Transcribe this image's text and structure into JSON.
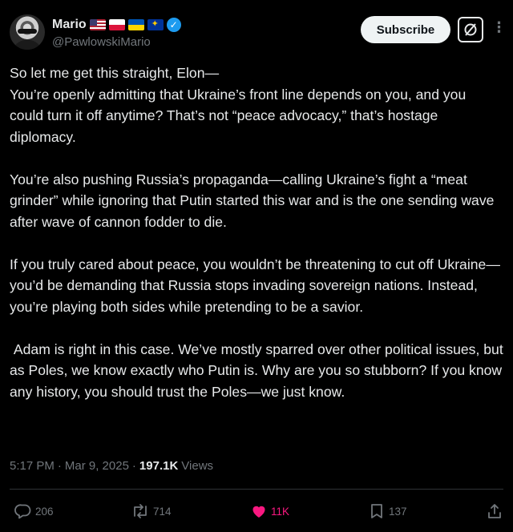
{
  "author": {
    "display_name": "Mario",
    "handle": "@PawlowskiMario",
    "flags": [
      "us-flag",
      "poland-flag",
      "ukraine-flag",
      "eu-flag"
    ],
    "verified": true
  },
  "header": {
    "subscribe_label": "Subscribe",
    "grok_icon": "grok-icon",
    "more_icon": "more-icon"
  },
  "tweet": {
    "paragraphs": [
      "So let me get this straight, Elon—\nYou’re openly admitting that Ukraine’s front line depends on you, and you could turn it off anytime? That’s not “peace advocacy,” that’s hostage diplomacy.",
      "You’re also pushing Russia’s propaganda—calling Ukraine’s fight a “meat grinder” while ignoring that Putin started this war and is the one sending wave after wave of cannon fodder to die.",
      "If you truly cared about peace, you wouldn’t be threatening to cut off Ukraine—you’d be demanding that Russia stops invading sovereign nations. Instead, you’re playing both sides while pretending to be a savior.",
      " Adam is right in this case. We’ve mostly sparred over other political issues, but as Poles, we know exactly who Putin is. Why are you so stubborn? If you know any history, you should trust the Poles—we just know."
    ]
  },
  "meta": {
    "time": "5:17 PM",
    "separator1": "·",
    "date": "Mar 9, 2025",
    "separator2": "·",
    "views_count": "197.1K",
    "views_label": "Views"
  },
  "actions": {
    "reply_count": "206",
    "retweet_count": "714",
    "like_count": "11K",
    "bookmark_count": "137"
  },
  "colors": {
    "background": "#000000",
    "text": "#e7e9ea",
    "secondary": "#71767b",
    "verified_blue": "#1d9bf0",
    "like_pink": "#f91880",
    "divider": "#2f3336"
  }
}
